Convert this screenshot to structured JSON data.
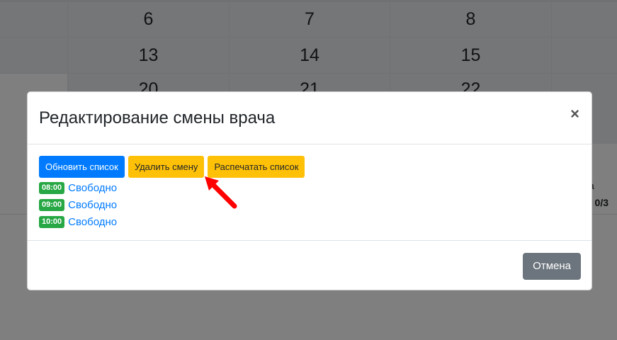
{
  "calendar": {
    "rows": [
      {
        "cells": [
          "",
          "6",
          "7",
          "8",
          ""
        ]
      },
      {
        "cells": [
          "",
          "13",
          "14",
          "15",
          ""
        ]
      },
      {
        "cells": [
          "",
          "20",
          "21",
          "22",
          ""
        ]
      }
    ],
    "side_texts": [
      "а",
      ": 0/3"
    ]
  },
  "modal": {
    "title": "Редактирование смены врача",
    "close_label": "×",
    "buttons": {
      "refresh": "Обновить список",
      "delete_shift": "Удалить смену",
      "print_list": "Распечатать список"
    },
    "slots": [
      {
        "time": "08:00",
        "status": "Свободно"
      },
      {
        "time": "09:00",
        "status": "Свободно"
      },
      {
        "time": "10:00",
        "status": "Свободно"
      }
    ],
    "footer": {
      "cancel": "Отмена"
    }
  },
  "colors": {
    "primary": "#007bff",
    "warning": "#ffc107",
    "success": "#28a745",
    "secondary": "#6c757d",
    "annotation_arrow": "#ff0000"
  },
  "icons": {
    "close": "close-icon",
    "annotation": "red-arrow-icon"
  }
}
